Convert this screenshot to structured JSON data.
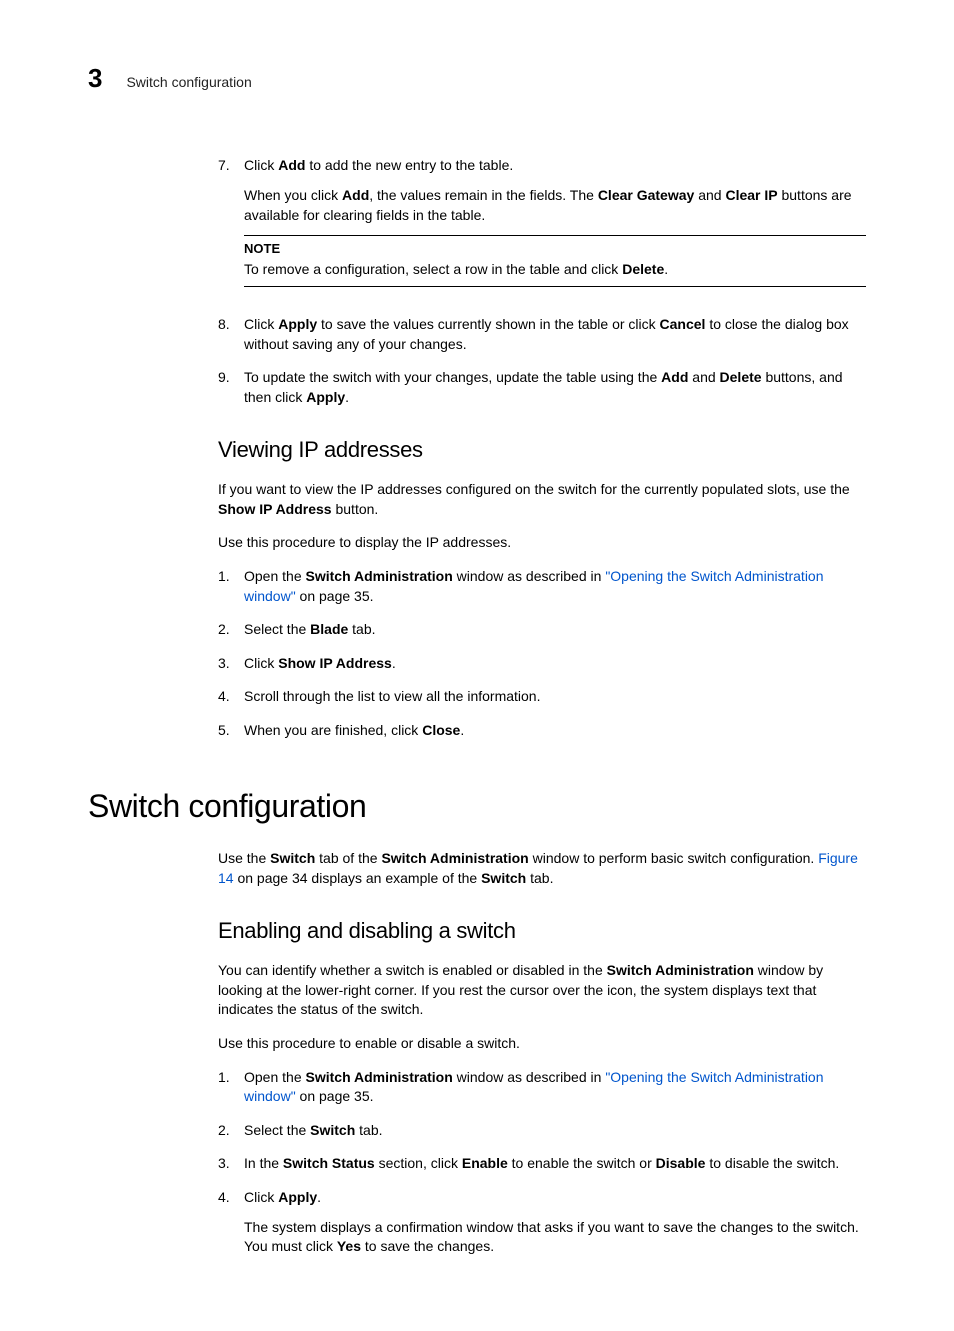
{
  "header": {
    "chapter_number": "3",
    "running_title": "Switch configuration"
  },
  "sections": {
    "step7": {
      "num": "7.",
      "p1a": "Click ",
      "p1b": "Add",
      "p1c": " to add the new entry to the table.",
      "p2a": "When you click ",
      "p2b": "Add",
      "p2c": ", the values remain in the fields. The ",
      "p2d": "Clear Gateway",
      "p2e": " and ",
      "p2f": "Clear IP",
      "p2g": " buttons are available for clearing fields in the table.",
      "note_label": "NOTE",
      "note_a": "To remove a configuration, select a row in the table and click ",
      "note_b": "Delete",
      "note_c": "."
    },
    "step8": {
      "num": "8.",
      "a": "Click ",
      "b": "Apply",
      "c": " to save the values currently shown in the table or click ",
      "d": "Cancel",
      "e": " to close the dialog box without saving any of your changes."
    },
    "step9": {
      "num": "9.",
      "a": "To update the switch with your changes, update the table using the ",
      "b": "Add",
      "c": " and ",
      "d": "Delete",
      "e": " buttons, and then click ",
      "f": "Apply",
      "g": "."
    },
    "viewing": {
      "heading": "Viewing IP addresses",
      "p1a": "If you want to view the IP addresses configured on the switch for the currently populated slots, use the ",
      "p1b": "Show IP Address",
      "p1c": " button.",
      "p2": "Use this procedure to display the IP addresses.",
      "s1": {
        "num": "1.",
        "a": "Open the ",
        "b": "Switch Administration",
        "c": " window as described in ",
        "link": "\"Opening the Switch Administration window\"",
        "d": " on page 35."
      },
      "s2": {
        "num": "2.",
        "a": "Select the ",
        "b": "Blade",
        "c": " tab."
      },
      "s3": {
        "num": "3.",
        "a": "Click ",
        "b": "Show IP Address",
        "c": "."
      },
      "s4": {
        "num": "4.",
        "a": "Scroll through the list to view all the information."
      },
      "s5": {
        "num": "5.",
        "a": "When you are finished, click ",
        "b": "Close",
        "c": "."
      }
    },
    "switchconf": {
      "heading": "Switch configuration",
      "p1a": "Use the ",
      "p1b": "Switch",
      "p1c": " tab of the ",
      "p1d": "Switch Administration",
      "p1e": " window to perform basic switch configuration. ",
      "link": "Figure 14",
      "p1f": " on page 34 displays an example of the ",
      "p1g": "Switch",
      "p1h": " tab."
    },
    "enabling": {
      "heading": "Enabling and disabling a switch",
      "p1a": "You can identify whether a switch is enabled or disabled in the ",
      "p1b": "Switch Administration",
      "p1c": " window by looking at the lower-right corner. If you rest the cursor over the icon, the system displays text that indicates the status of the switch.",
      "p2": "Use this procedure to enable or disable a switch.",
      "s1": {
        "num": "1.",
        "a": "Open the ",
        "b": "Switch Administration",
        "c": " window as described in ",
        "link": "\"Opening the Switch Administration window\"",
        "d": " on page 35."
      },
      "s2": {
        "num": "2.",
        "a": "Select the ",
        "b": "Switch",
        "c": " tab."
      },
      "s3": {
        "num": "3.",
        "a": "In the ",
        "b": "Switch Status",
        "c": " section, click ",
        "d": "Enable",
        "e": " to enable the switch or ",
        "f": "Disable",
        "g": " to disable the switch."
      },
      "s4": {
        "num": "4.",
        "a": "Click ",
        "b": "Apply",
        "c": ".",
        "p2a": "The system displays a confirmation window that asks if you want to save the changes to the switch. You must click ",
        "p2b": "Yes",
        "p2c": " to save the changes."
      }
    }
  }
}
